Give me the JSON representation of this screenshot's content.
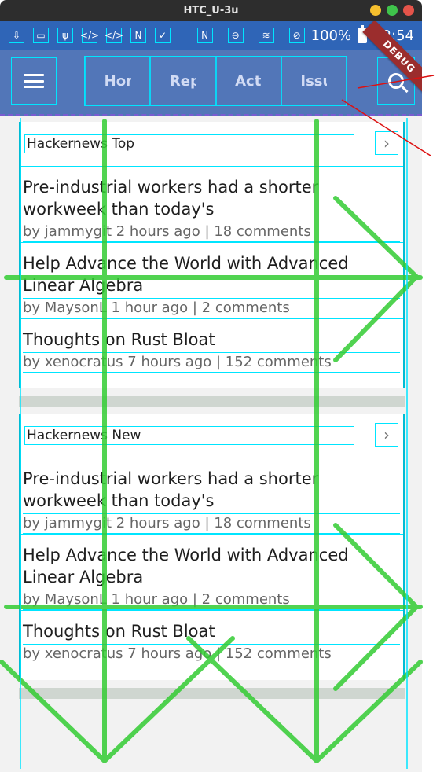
{
  "window": {
    "title": "HTC_U-3u"
  },
  "status_bar": {
    "battery": "100%",
    "time": "12:54"
  },
  "debug": {
    "label": "DEBUG"
  },
  "tabs": [
    {
      "label": "Home"
    },
    {
      "label": "Repo"
    },
    {
      "label": "Activity"
    },
    {
      "label": "Issues"
    }
  ],
  "sections": [
    {
      "title": "Hackernews Top",
      "stories": [
        {
          "title": "Pre-industrial workers had a shorter workweek than today's",
          "meta": "by jammygit 2 hours ago | 18 comments"
        },
        {
          "title": "Help Advance the World with Advanced Linear Algebra",
          "meta": "by MaysonL 1 hour ago | 2 comments"
        },
        {
          "title": "Thoughts on Rust Bloat",
          "meta": "by xenocratus 7 hours ago | 152 comments"
        }
      ]
    },
    {
      "title": "Hackernews New",
      "stories": [
        {
          "title": "Pre-industrial workers had a shorter workweek than today's",
          "meta": "by jammygit 2 hours ago | 18 comments"
        },
        {
          "title": "Help Advance the World with Advanced Linear Algebra",
          "meta": "by MaysonL 1 hour ago | 2 comments"
        },
        {
          "title": "Thoughts on Rust Bloat",
          "meta": "by xenocratus 7 hours ago | 152 comments"
        }
      ]
    }
  ],
  "colors": {
    "status_bar": "#2f65b7",
    "app_bar": "#5276b8",
    "debug_overlay": "#00e5ff",
    "gesture_overlay": "#33cc33"
  },
  "icons": {
    "menu": "hamburger-icon",
    "search": "search-icon",
    "more": "chevron-right-icon"
  }
}
